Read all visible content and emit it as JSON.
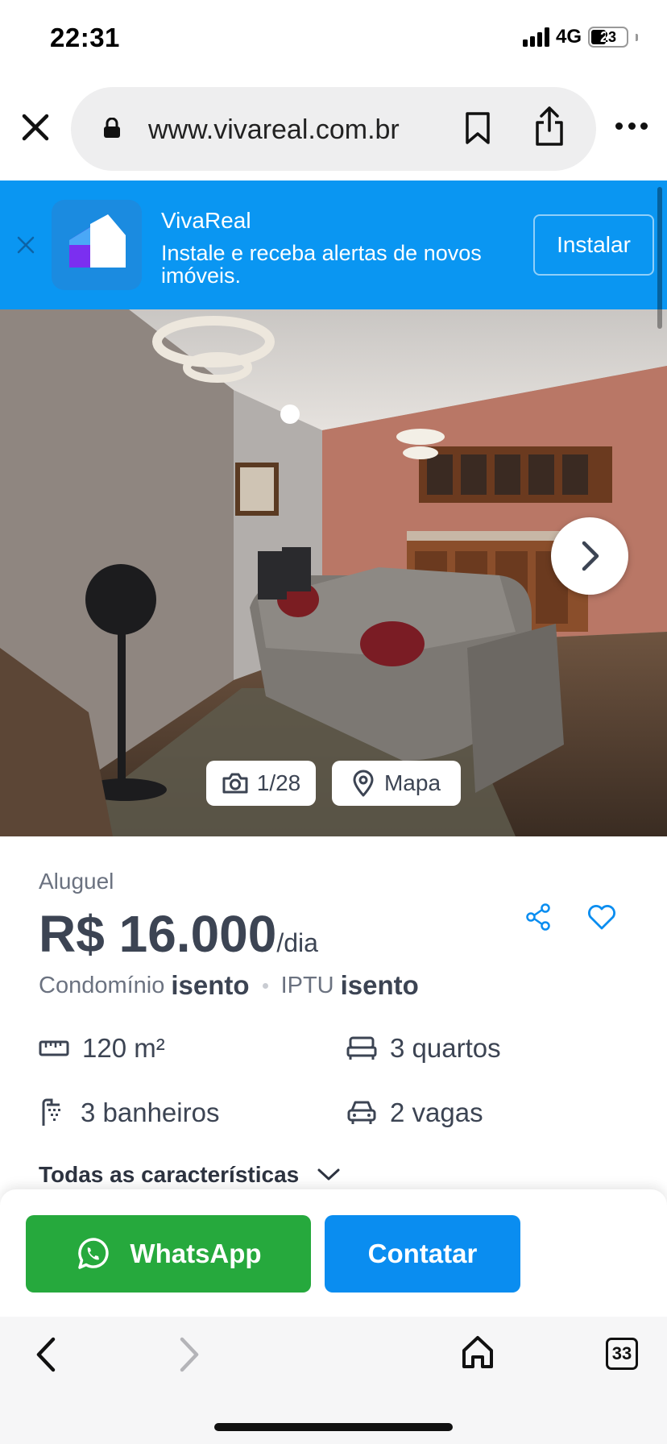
{
  "status_bar": {
    "time": "22:31",
    "network": "4G",
    "battery_level": "23"
  },
  "browser": {
    "url": "www.vivareal.com.br",
    "icons": [
      "close-icon",
      "lock-icon",
      "bookmark-icon",
      "share-icon",
      "more-icon"
    ]
  },
  "app_banner": {
    "title": "VivaReal",
    "subtitle": "Instale e receba alertas de novos imóveis.",
    "install_label": "Instalar",
    "background_color": "#0a96f2"
  },
  "gallery": {
    "photo_counter": "1/28",
    "map_label": "Mapa"
  },
  "listing": {
    "business_type": "Aluguel",
    "price": "R$ 16.000",
    "price_period": "/dia",
    "condo_label": "Condomínio",
    "condo_value": "isento",
    "iptu_label": "IPTU",
    "iptu_value": "isento",
    "amenities": {
      "area": "120 m²",
      "bedrooms": "3 quartos",
      "bathrooms": "3 banheiros",
      "parking": "2 vagas"
    },
    "all_features_label": "Todas as características"
  },
  "cta": {
    "whatsapp_label": "WhatsApp",
    "contact_label": "Contatar",
    "whatsapp_color": "#26a93d",
    "contact_color": "#0a8df0"
  },
  "toolbar": {
    "tabs_count": "33"
  }
}
